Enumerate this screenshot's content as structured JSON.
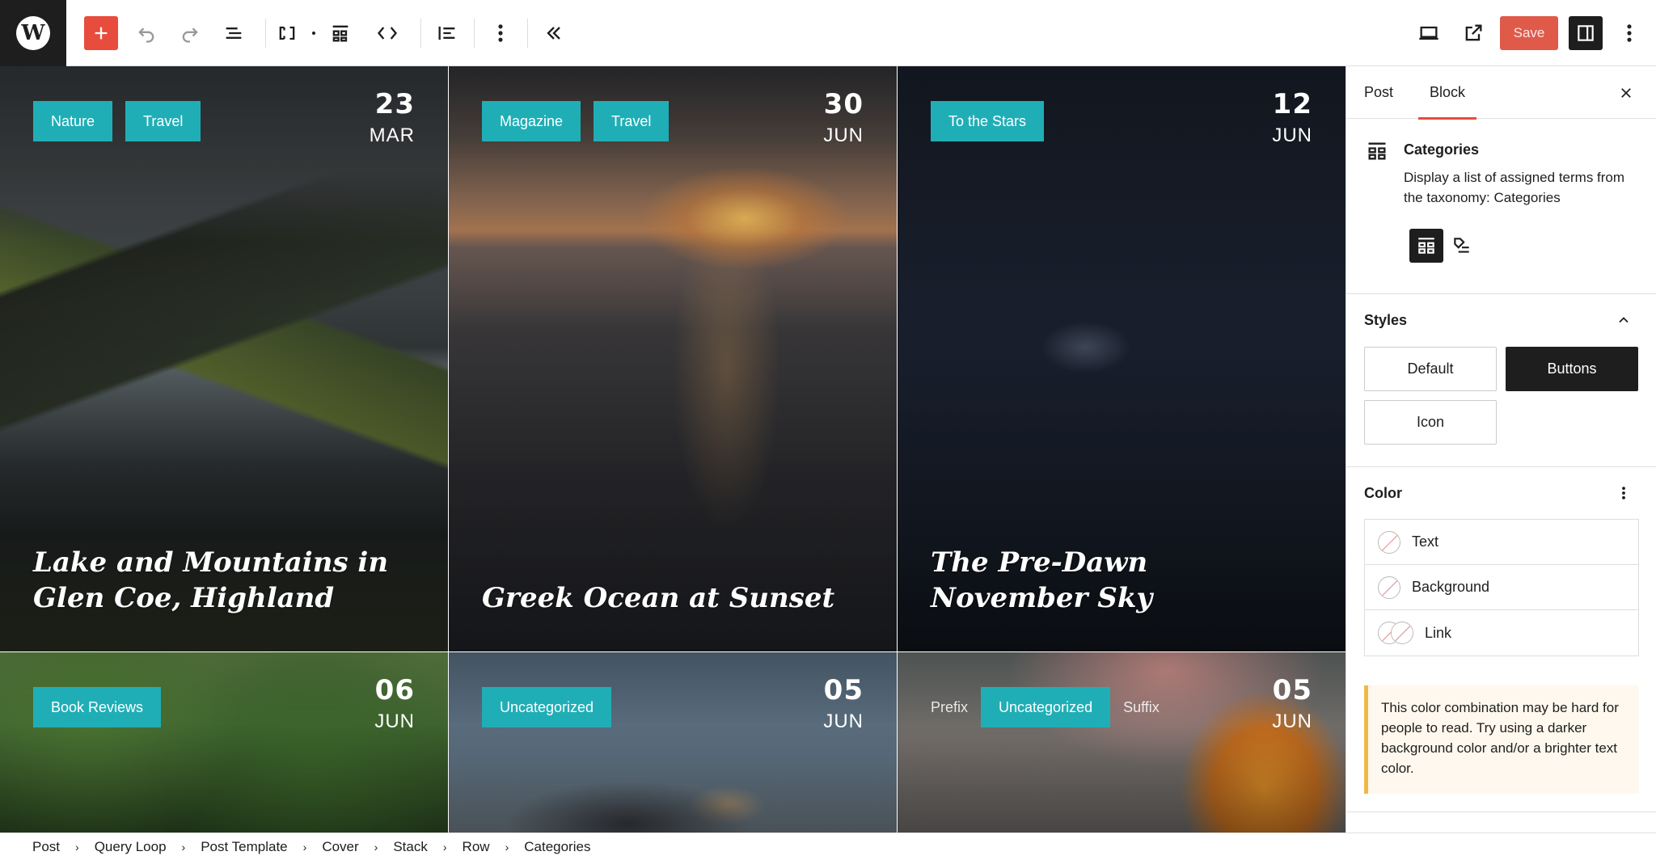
{
  "toolbar": {
    "save_label": "Save"
  },
  "cards": [
    {
      "categories": [
        "Nature",
        "Travel"
      ],
      "day": "23",
      "month": "MAR",
      "title": "Lake and Mountains in Glen Coe, Highland"
    },
    {
      "categories": [
        "Magazine",
        "Travel"
      ],
      "day": "30",
      "month": "JUN",
      "title": "Greek Ocean at Sunset"
    },
    {
      "categories": [
        "To the Stars"
      ],
      "day": "12",
      "month": "JUN",
      "title": "The Pre-Dawn November Sky"
    },
    {
      "categories": [
        "Book Reviews"
      ],
      "day": "06",
      "month": "JUN"
    },
    {
      "categories": [
        "Uncategorized"
      ],
      "day": "05",
      "month": "JUN"
    },
    {
      "prefix": "Prefix",
      "categories": [
        "Uncategorized"
      ],
      "suffix": "Suffix",
      "day": "05",
      "month": "JUN"
    }
  ],
  "breadcrumb": [
    "Post",
    "Query Loop",
    "Post Template",
    "Cover",
    "Stack",
    "Row",
    "Categories"
  ],
  "sidebar": {
    "tabs": [
      "Post",
      "Block"
    ],
    "active_tab": "Block",
    "block": {
      "name": "Categories",
      "description": "Display a list of assigned terms from the taxonomy: Categories"
    },
    "styles": {
      "heading": "Styles",
      "options": [
        "Default",
        "Buttons",
        "Icon"
      ],
      "selected": "Buttons"
    },
    "color": {
      "heading": "Color",
      "items": [
        "Text",
        "Background",
        "Link"
      ]
    },
    "notice": "This color combination may be hard for people to read. Try using a darker background color and/or a brighter text color."
  },
  "colors": {
    "chip": "#20aeb6",
    "accent": "#e74c3c",
    "notice_border": "#f0b849"
  }
}
